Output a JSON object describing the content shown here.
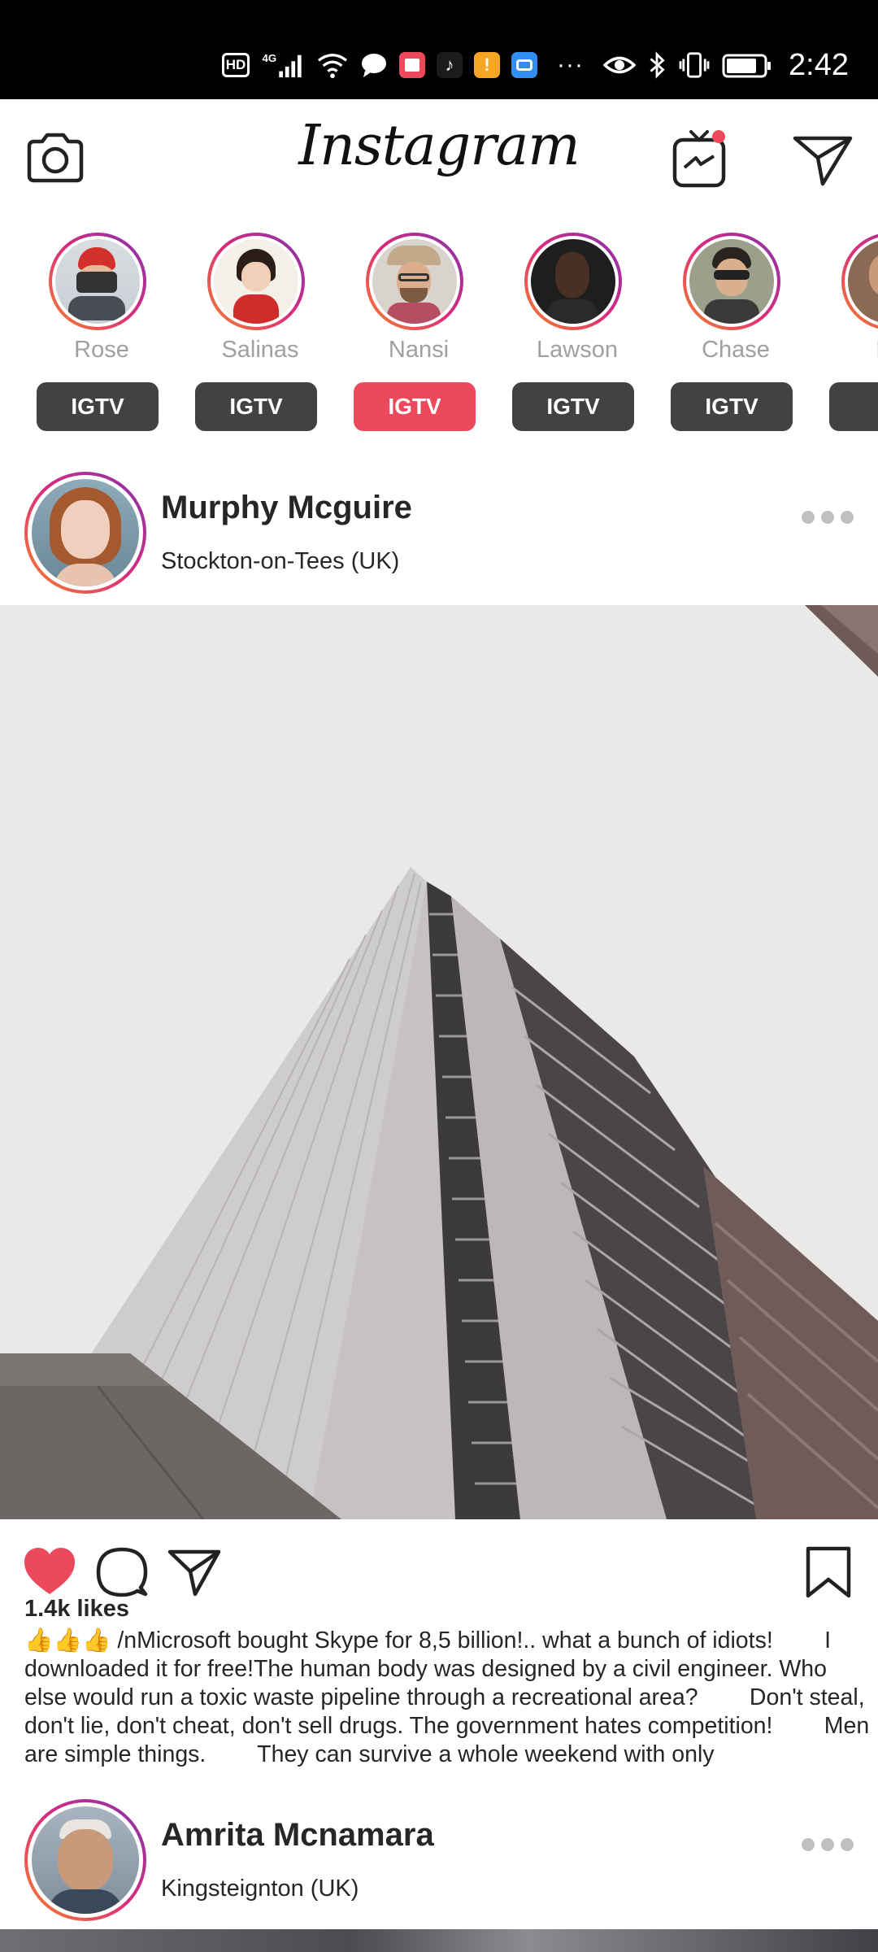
{
  "status_bar": {
    "time": "2:42",
    "hd_label": "HD",
    "network_label": "4G",
    "icons": [
      "hd-icon",
      "signal-icon",
      "wifi-icon",
      "chat-bubble-icon",
      "book-app-icon",
      "tiktok-app-icon",
      "notification-app-icon",
      "cloud-app-icon",
      "more-dots-icon",
      "eye-icon",
      "bluetooth-icon",
      "vibrate-icon",
      "battery-icon"
    ]
  },
  "header": {
    "logo_text": "Instagram",
    "left_icon": "camera-icon",
    "right_icons": [
      "igtv-icon",
      "direct-message-icon"
    ],
    "notification_color": "#ec4a5c"
  },
  "stories": [
    {
      "name": "Rose",
      "badge": "IGTV",
      "active": false
    },
    {
      "name": "Salinas",
      "badge": "IGTV",
      "active": false
    },
    {
      "name": "Nansi",
      "badge": "IGTV",
      "active": true
    },
    {
      "name": "Lawson",
      "badge": "IGTV",
      "active": false
    },
    {
      "name": "Chase",
      "badge": "IGTV",
      "active": false
    },
    {
      "name": "Bro",
      "badge": "IG",
      "active": false
    }
  ],
  "posts": [
    {
      "user": "Murphy Mcguire",
      "location": "Stockton-on-Tees (UK)",
      "likes": "1.4k likes",
      "liked": true,
      "caption": "👍👍👍 /nMicrosoft bought Skype for 8,5 billion!.. what a bunch of idiots!        I downloaded it for free!The human body was designed by a civil engineer. Who else would run a toxic waste pipeline through a recreational area?        Don't steal, don't lie, don't cheat, don't sell drugs. The government hates competition!        Men are simple things.        They can survive a whole weekend with only"
    },
    {
      "user": "Amrita Mcnamara",
      "location": "Kingsteignton (UK)"
    }
  ],
  "colors": {
    "accent": "#ec4a5c",
    "badge_default": "#424242",
    "status_bar": "#000000"
  }
}
